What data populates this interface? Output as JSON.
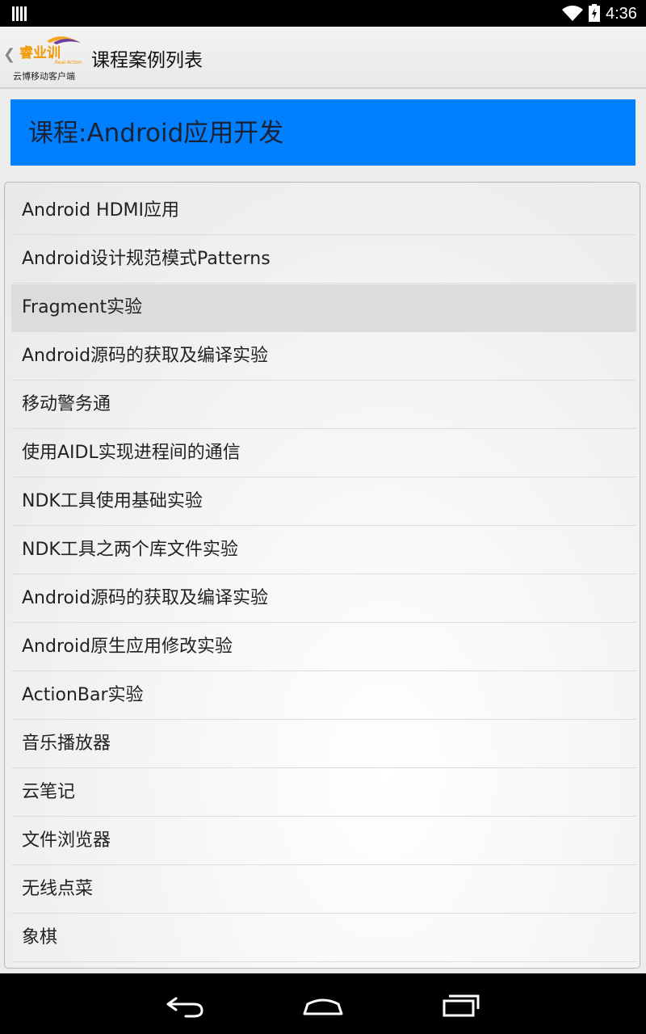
{
  "status_bar": {
    "time": "4:36",
    "icons": [
      "notification-icon",
      "wifi-icon",
      "battery-charging-icon"
    ]
  },
  "action_bar": {
    "up_icon": "chevron-left-icon",
    "logo_text": "睿业训",
    "logo_tagline": "Real Action",
    "logo_subtitle": "云博移动客户端",
    "title": "课程案例列表"
  },
  "course": {
    "label": "课程:Android应用开发",
    "banner_color": "#0080ff"
  },
  "list": {
    "selected_index": 2,
    "items": [
      "Android HDMI应用",
      "Android设计规范模式Patterns",
      "Fragment实验",
      "Android源码的获取及编译实验",
      "移动警务通",
      "使用AIDL实现进程间的通信",
      "NDK工具使用基础实验",
      "NDK工具之两个库文件实验",
      "Android源码的获取及编译实验",
      "Android原生应用修改实验",
      "ActionBar实验",
      "音乐播放器",
      "云笔记",
      "文件浏览器",
      "无线点菜",
      "象棋"
    ]
  },
  "nav_bar": {
    "icons": [
      "back-icon",
      "home-icon",
      "recent-apps-icon"
    ]
  }
}
